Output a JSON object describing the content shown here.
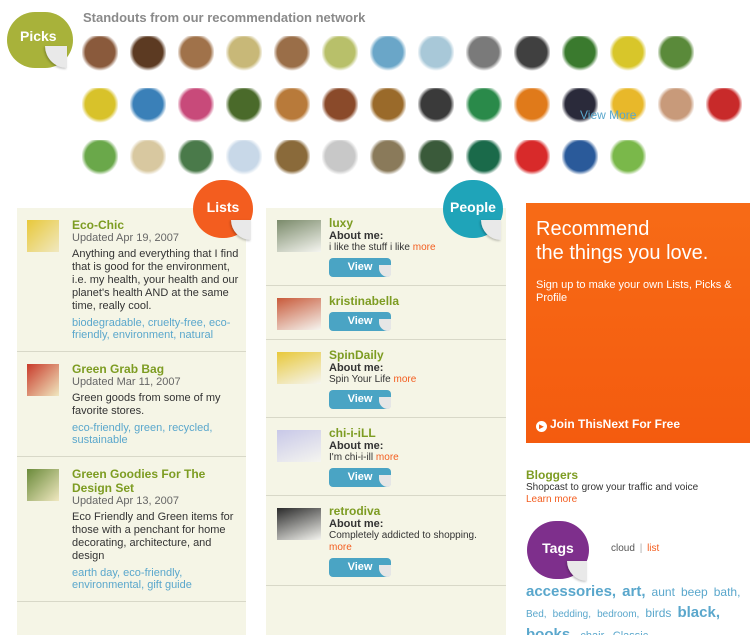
{
  "picks": {
    "badge_label": "Picks",
    "title": "Standouts from our recommendation network",
    "view_more": "View More",
    "thumb_colors": [
      [
        "#8a5a3c",
        "#5c3a22",
        "#a0724a",
        "#c8b878",
        "#9a6e48",
        "#b8c06a",
        "#6aa6c8",
        "#a8c8d8",
        "#7a7a7a",
        "#404040",
        "#3a7a2e",
        "#d8c62a",
        "#5a8a3a"
      ],
      [
        "#d8c22a",
        "#3a80b8",
        "#c84a7a",
        "#4a6a2a",
        "#b87a3a",
        "#8a4a2a",
        "#9a6a2a",
        "#3a3a3a",
        "#2a8a4a",
        "#e07a1a",
        "#2a2a3a",
        "#e8b82a",
        "#c89a7a",
        "#c82a2a"
      ],
      [
        "#6aa84a",
        "#d8c8a0",
        "#4a7a4a",
        "#c8d8e8",
        "#8a6a3a",
        "#c8c8c8",
        "#8a7a5a",
        "#3a5a3a",
        "#1a6a4a",
        "#d82a2a",
        "#2a5a9a",
        "#7ab84a"
      ]
    ]
  },
  "lists": {
    "badge_label": "Lists",
    "items": [
      {
        "title": "Eco-Chic",
        "date": "Updated Apr 19, 2007",
        "description": "Anything and everything that I find that is good for the environment, i.e. my health, your health and our planet's health AND at the same time, really cool.",
        "tags": [
          "biodegradable, ",
          "cruelty-free, ",
          "eco-friendly, ",
          "environment, ",
          "natural"
        ]
      },
      {
        "title": "Green Grab Bag",
        "date": "Updated Mar 11, 2007",
        "description": "Green goods from some of my favorite stores.",
        "tags": [
          "eco-friendly, ",
          "green, ",
          "recycled, ",
          "sustainable"
        ]
      },
      {
        "title": "Green Goodies For The Design Set",
        "date": "Updated Apr 13, 2007",
        "description": "Eco Friendly and Green items for those with a penchant for home decorating, architecture, and design",
        "tags": [
          "earth day, ",
          "eco-friendly, ",
          "environmental, ",
          "gift guide"
        ]
      }
    ]
  },
  "people": {
    "badge_label": "People",
    "about_label": "About me:",
    "more_label": "more",
    "view_label": "View",
    "items": [
      {
        "name": "luxy",
        "bio": "i like the stuff i like",
        "has_about": true
      },
      {
        "name": "kristinabella",
        "bio": "",
        "has_about": false
      },
      {
        "name": "SpinDaily",
        "bio": "Spin Your Life",
        "has_about": true
      },
      {
        "name": "chi-i-iLL",
        "bio": "I'm chi-i-ill",
        "has_about": true
      },
      {
        "name": "retrodiva",
        "bio": "Completely addicted to shopping.",
        "has_about": true
      }
    ]
  },
  "promo": {
    "headline_line1": "Recommend",
    "headline_line2": "the things you love.",
    "subtext": "Sign up to make your own Lists, Picks & Profile",
    "join": "Join ThisNext For Free"
  },
  "bloggers": {
    "title": "Bloggers",
    "text": "Shopcast to grow your traffic and voice",
    "link": "Learn more"
  },
  "tags": {
    "badge_label": "Tags",
    "cloud_label": "cloud",
    "separator": "|",
    "list_label": "list",
    "cloud": [
      {
        "text": "accessories,",
        "size": "xl"
      },
      {
        "text": "art,",
        "size": "xl"
      },
      {
        "text": "aunt",
        "size": "l"
      },
      {
        "text": "beep",
        "size": "l"
      },
      {
        "text": "bath,",
        "size": "l"
      },
      {
        "text": "Bed,",
        "size": "s"
      },
      {
        "text": "bedding,",
        "size": "s"
      },
      {
        "text": "bedroom,",
        "size": "s"
      },
      {
        "text": "birds",
        "size": "l"
      },
      {
        "text": "black,",
        "size": "xl"
      },
      {
        "text": "books,",
        "size": "xl"
      },
      {
        "text": "chair,",
        "size": "m"
      },
      {
        "text": "Classic",
        "size": "m"
      }
    ]
  },
  "colors": {
    "picks": "#a8b23a",
    "lists": "#f35d1f",
    "people": "#1fa4b9",
    "tags": "#7e2f8c",
    "link_green": "#7d9c22",
    "link_blue": "#5aa7cc",
    "promo_orange": "#f45b0f"
  }
}
